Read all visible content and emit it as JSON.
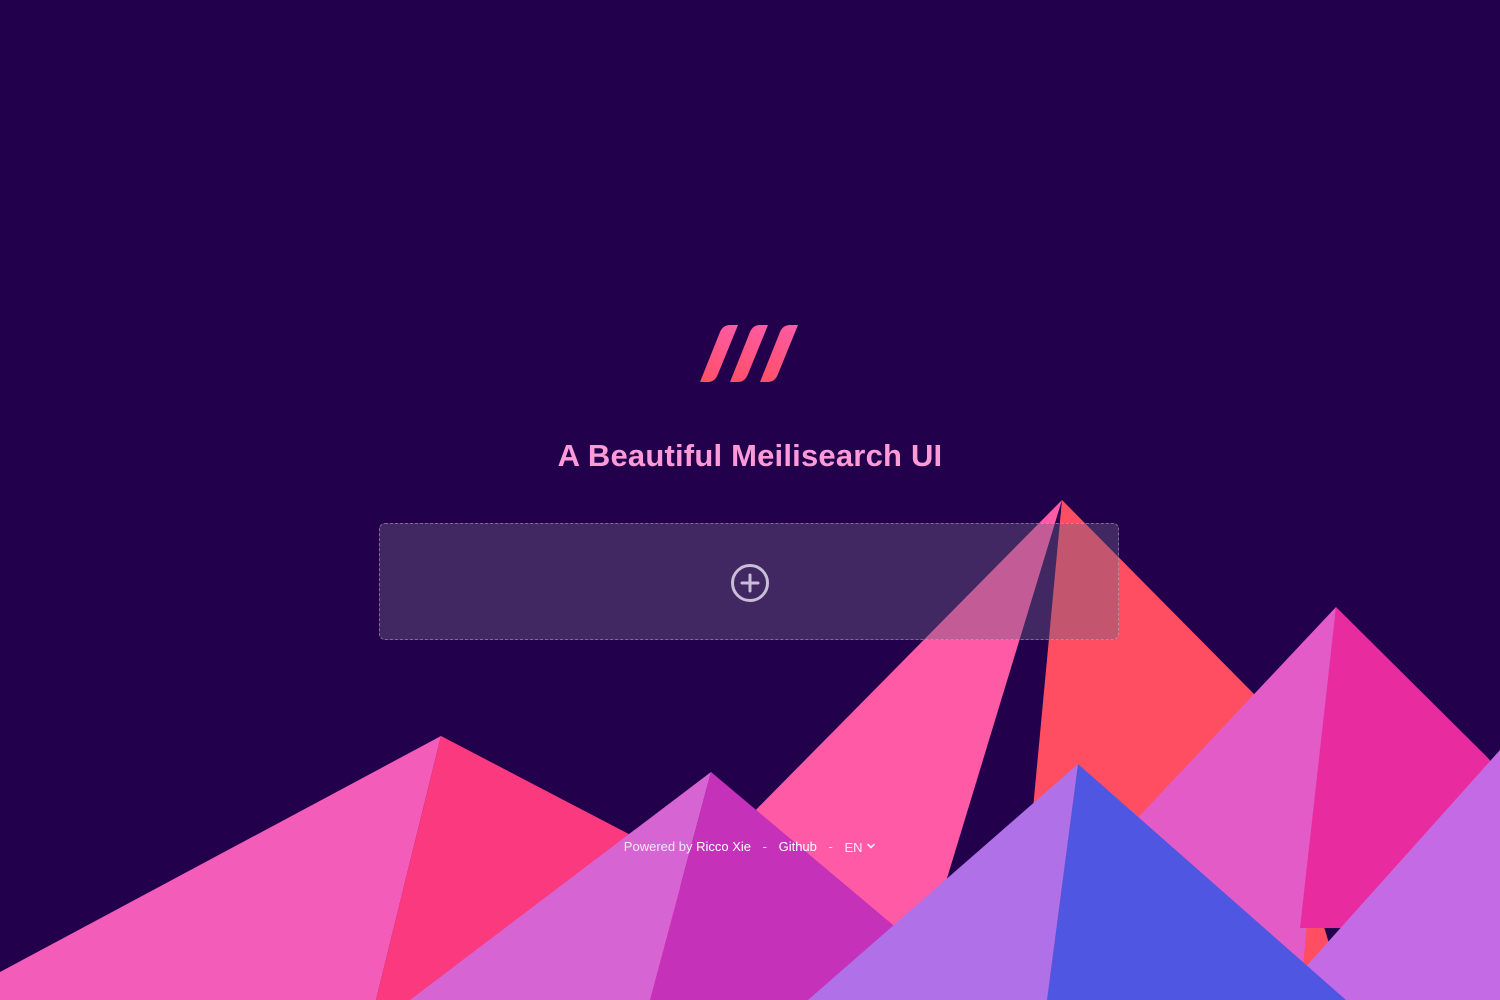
{
  "app": {
    "title": "A Beautiful Meilisearch UI",
    "logo_icon": "meilisearch-logo-icon"
  },
  "instances": {
    "add_icon": "plus-circle-icon"
  },
  "footer": {
    "powered_by_label": "Powered by",
    "author_link": "Ricco Xie",
    "separator_1": "-",
    "github_link": "Github",
    "separator_2": "-",
    "language_selected": "EN",
    "language_chevron": "chevron-down-icon"
  },
  "colors": {
    "background": "#22004c",
    "title": "#ff9ad8",
    "logo_gradient_start": "#ff5caa",
    "logo_gradient_end": "#ff4e62",
    "mountain_pink": "#f45cb9",
    "mountain_red": "#ff4e62",
    "mountain_purple": "#b070e8",
    "mountain_blue": "#4f57e2"
  }
}
